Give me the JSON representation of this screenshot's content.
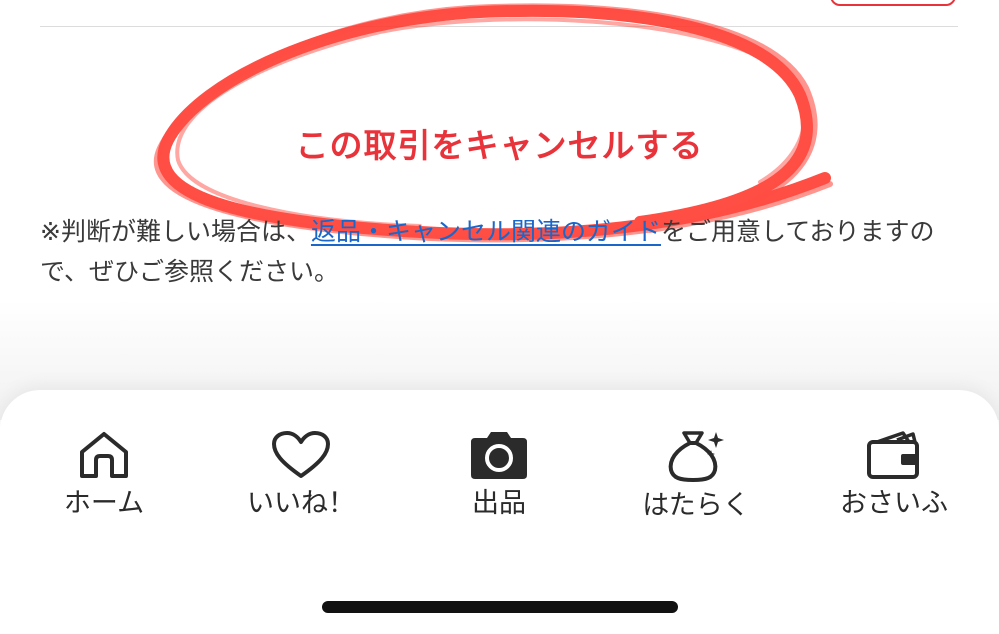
{
  "cancel": {
    "label": "この取引をキャンセルする"
  },
  "notice": {
    "prefix": "※判断が難しい場合は、",
    "link": "返品・キャンセル関連のガイド",
    "suffix": "をご用意しておりますので、ぜひご参照ください。"
  },
  "tabs": [
    {
      "label": "ホーム",
      "icon": "home-icon"
    },
    {
      "label": "いいね！",
      "icon": "heart-icon"
    },
    {
      "label": "出品",
      "icon": "camera-icon"
    },
    {
      "label": "はたらく",
      "icon": "money-bag-icon"
    },
    {
      "label": "おさいふ",
      "icon": "wallet-icon"
    }
  ],
  "colors": {
    "accent_red": "#e8333a",
    "link_blue": "#1a66c9",
    "scribble_red": "#ff3b30"
  }
}
